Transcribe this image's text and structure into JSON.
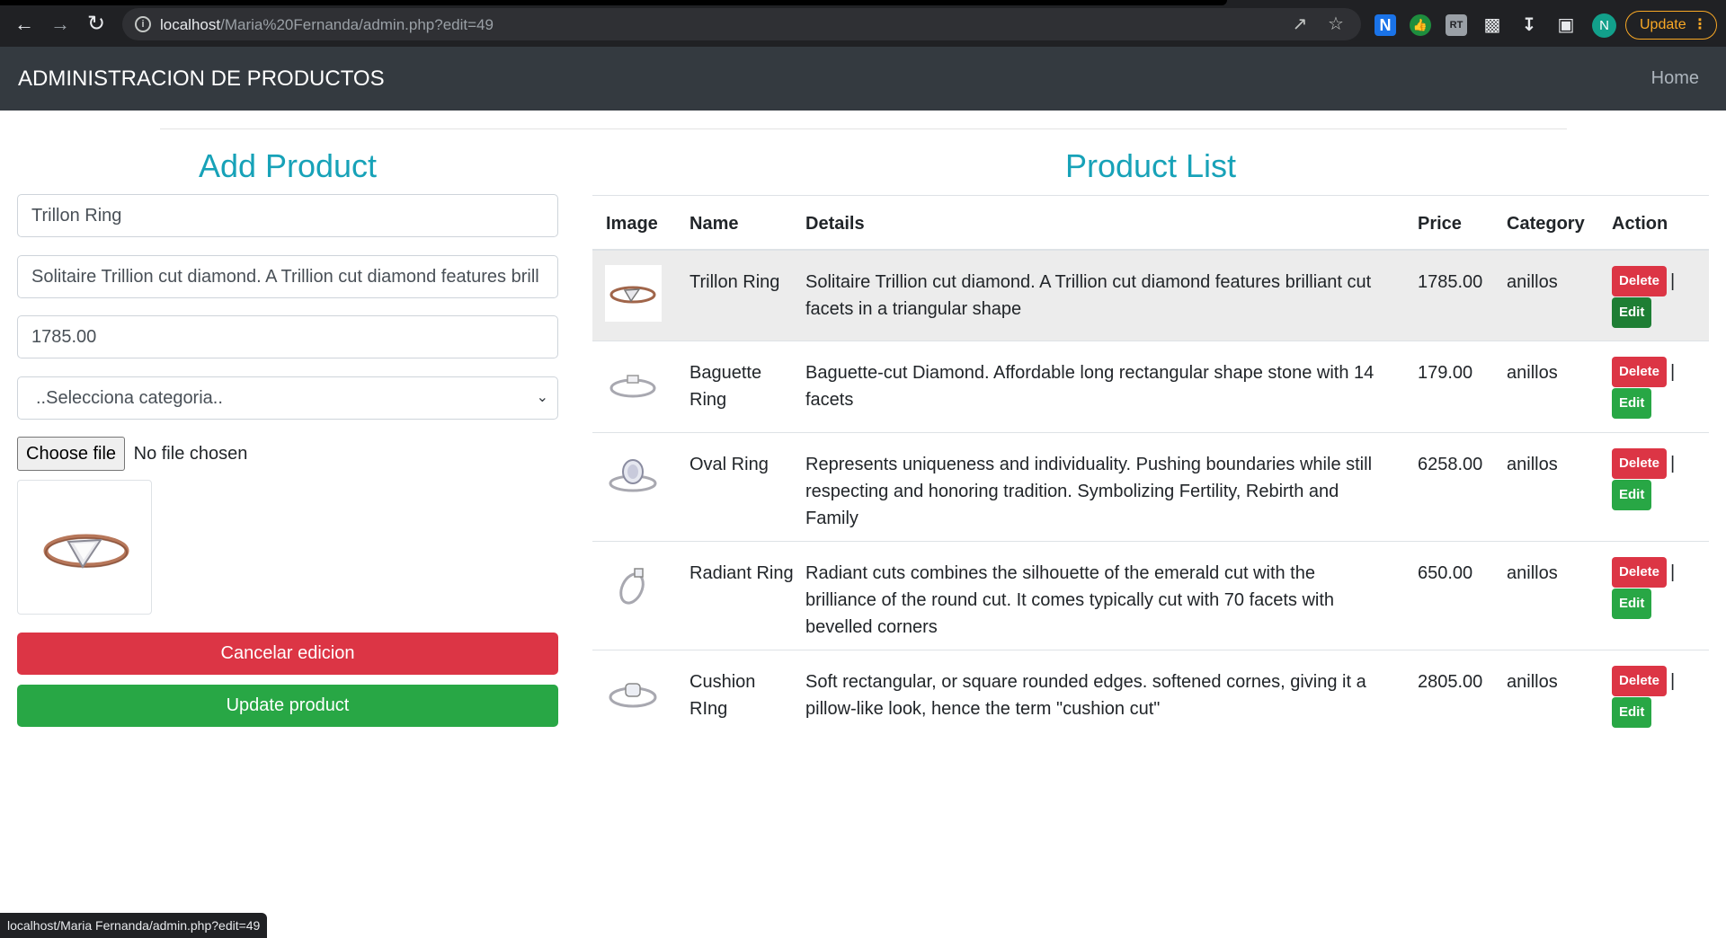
{
  "browser": {
    "url_host": "localhost",
    "url_path": "/Maria%20Fernanda/admin.php?edit=49",
    "profile_initial": "N",
    "update_label": "Update",
    "extensions": [
      "N",
      "",
      "RT"
    ]
  },
  "navbar": {
    "brand": "ADMINISTRACION DE PRODUCTOS",
    "home": "Home"
  },
  "form": {
    "title": "Add Product",
    "name_value": "Trillon Ring",
    "details_value": "Solitaire Trillion cut diamond. A Trillion cut diamond features brill",
    "price_value": "1785.00",
    "category_selected": "..Selecciona categoria..",
    "file_button": "Choose file",
    "file_status": "No file chosen",
    "cancel_label": "Cancelar edicion",
    "update_label": "Update product"
  },
  "list": {
    "title": "Product List",
    "headers": {
      "image": "Image",
      "name": "Name",
      "details": "Details",
      "price": "Price",
      "category": "Category",
      "action": "Action"
    },
    "delete_label": "Delete",
    "edit_label": "Edit",
    "separator": "|",
    "rows": [
      {
        "name": "Trillon Ring",
        "details": "Solitaire Trillion cut diamond. A Trillion cut diamond features brilliant cut facets in a triangular shape",
        "price": "1785.00",
        "category": "anillos"
      },
      {
        "name": "Baguette Ring",
        "details": "Baguette-cut Diamond. Affordable long rectangular shape stone with 14 facets",
        "price": "179.00",
        "category": "anillos"
      },
      {
        "name": "Oval Ring",
        "details": "Represents uniqueness and individuality. Pushing boundaries while still respecting and honoring tradition. Symbolizing Fertility, Rebirth and Family",
        "price": "6258.00",
        "category": "anillos"
      },
      {
        "name": "Radiant Ring",
        "details": "Radiant cuts combines the silhouette of the emerald cut with the brilliance of the round cut. It comes typically cut with 70 facets with bevelled corners",
        "price": "650.00",
        "category": "anillos"
      },
      {
        "name": "Cushion RIng",
        "details": "Soft rectangular, or square rounded edges. softened cornes, giving it a pillow-like look, hence the term \"cushion cut\"",
        "price": "2805.00",
        "category": "anillos"
      }
    ]
  },
  "statusbar": "localhost/Maria Fernanda/admin.php?edit=49",
  "colors": {
    "title_accent": "#17a2b8",
    "danger": "#dc3545",
    "success": "#28a745",
    "navbar_bg": "#343a40"
  }
}
